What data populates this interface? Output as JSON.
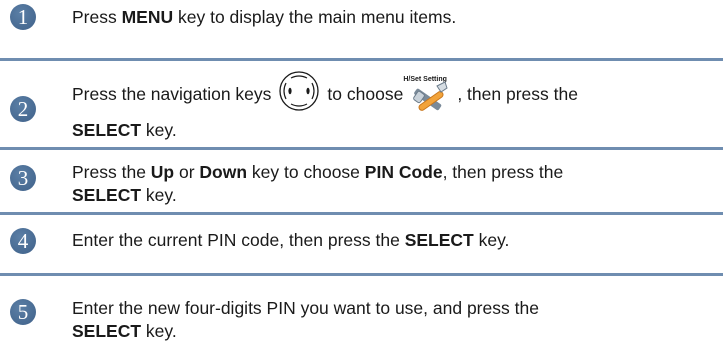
{
  "colors": {
    "badge": "#5b7fa6",
    "badge_dark": "#3f6189",
    "separator": "#6f8db0"
  },
  "steps": [
    {
      "number": "1",
      "parts": [
        "Press ",
        "MENU",
        " key to display the main menu items."
      ]
    },
    {
      "number": "2",
      "parts": [
        "Press the navigation keys",
        "to choose",
        ", then press the",
        "SELECT",
        " key."
      ],
      "icons": {
        "nav": "navigation-keys-icon",
        "setting": "handset-setting-icon"
      },
      "setting_caption": "H/Set Setting"
    },
    {
      "number": "3",
      "parts": [
        "Press the ",
        "Up",
        " or ",
        "Down",
        " key to choose ",
        "PIN Code",
        ", then press the ",
        "SELECT",
        " key."
      ]
    },
    {
      "number": "4",
      "parts": [
        "Enter the current PIN code, then press the ",
        "SELECT",
        " key."
      ]
    },
    {
      "number": "5",
      "parts": [
        "Enter the new four-digits PIN you want to use, and press the ",
        "SELECT",
        " key."
      ]
    }
  ]
}
